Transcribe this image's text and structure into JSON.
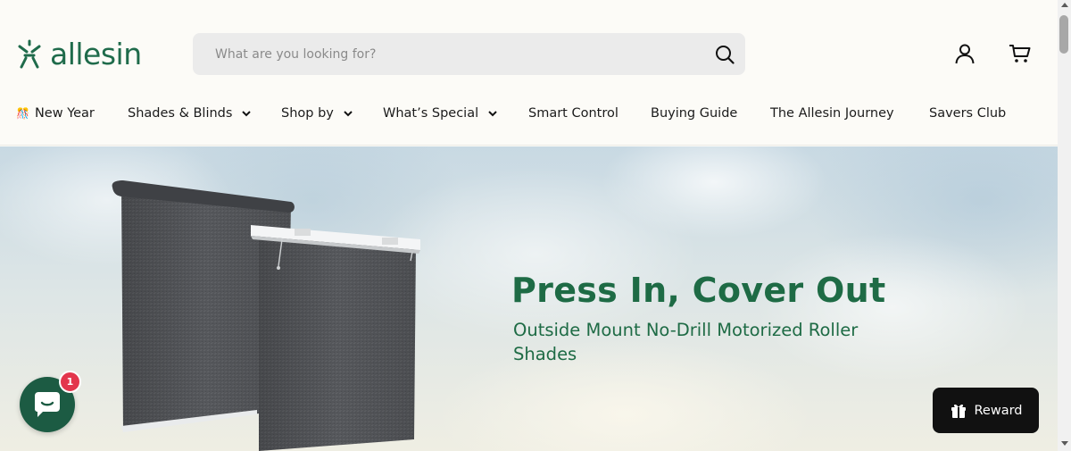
{
  "brand": {
    "logo_text": "allesin",
    "logo_icon": "allesin-person-logo-icon",
    "brand_color": "#1f6b4b"
  },
  "search": {
    "placeholder": "What are you looking for?",
    "value": "",
    "icon": "search-icon"
  },
  "header_icons": {
    "account": "account-icon",
    "cart": "cart-icon"
  },
  "nav": {
    "items": [
      {
        "label": "New Year",
        "icon": "party-popper-icon",
        "has_dropdown": false
      },
      {
        "label": "Shades & Blinds",
        "has_dropdown": true
      },
      {
        "label": "Shop by",
        "has_dropdown": true
      },
      {
        "label": "What’s Special",
        "has_dropdown": true
      },
      {
        "label": "Smart Control",
        "has_dropdown": false
      },
      {
        "label": "Buying Guide",
        "has_dropdown": false
      },
      {
        "label": "The Allesin Journey",
        "has_dropdown": false
      },
      {
        "label": "Savers Club",
        "has_dropdown": false
      }
    ]
  },
  "hero": {
    "title": "Press In, Cover Out",
    "subtitle": "Outside Mount No-Drill Motorized Roller Shades",
    "text_color": "#1e6b45",
    "image": "gray-roller-shades-image"
  },
  "chat_widget": {
    "icon": "chat-bubble-icon",
    "badge_count": "1",
    "badge_color": "#e3364d",
    "button_color": "#1c5b43"
  },
  "reward_widget": {
    "label": "Reward",
    "icon": "reward-gift-icon",
    "background": "#111111"
  }
}
